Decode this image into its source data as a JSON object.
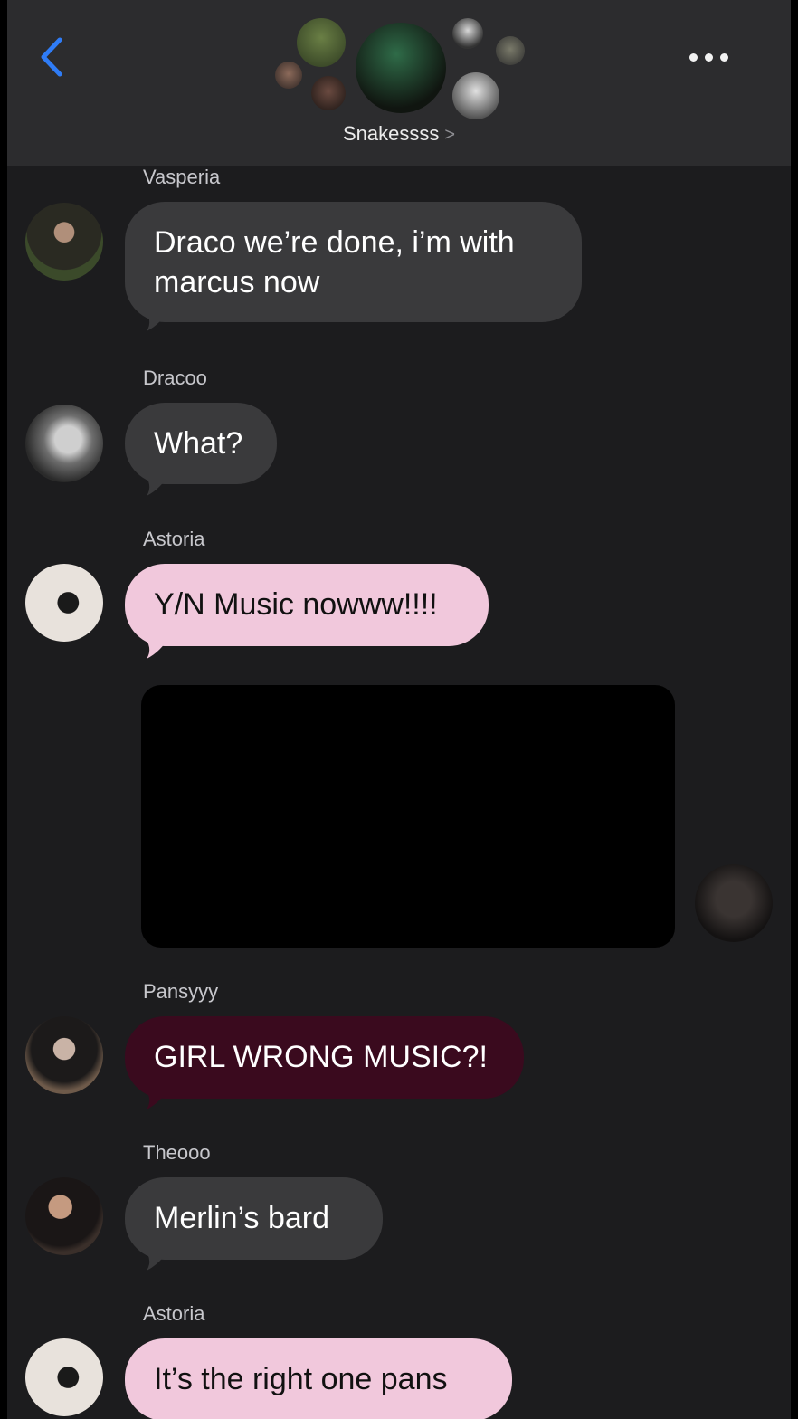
{
  "header": {
    "group_name": "Snakessss",
    "group_chevron": ">"
  },
  "messages": [
    {
      "sender": "Vasperia",
      "text": "Draco we’re done, i’m with marcus now",
      "style": "dark"
    },
    {
      "sender": "Dracoo",
      "text": "What?",
      "style": "dark"
    },
    {
      "sender": "Astoria",
      "text": "Y/N Music nowww!!!!",
      "style": "pink"
    },
    {
      "sender": "Pansyyy",
      "text": "GIRL WRONG MUSIC?!",
      "style": "maroon"
    },
    {
      "sender": "Theooo",
      "text": "Merlin’s bard",
      "style": "dark"
    },
    {
      "sender": "Astoria",
      "text": "It’s the right one pans",
      "style": "pink"
    }
  ],
  "colors": {
    "accent_blue": "#2f7cf6",
    "bubble_dark": "#3a3a3c",
    "bubble_pink": "#f1c8dc",
    "bubble_maroon": "#3a0a1e"
  },
  "icons": {
    "back": "chevron-left-icon",
    "more": "ellipsis-icon"
  }
}
